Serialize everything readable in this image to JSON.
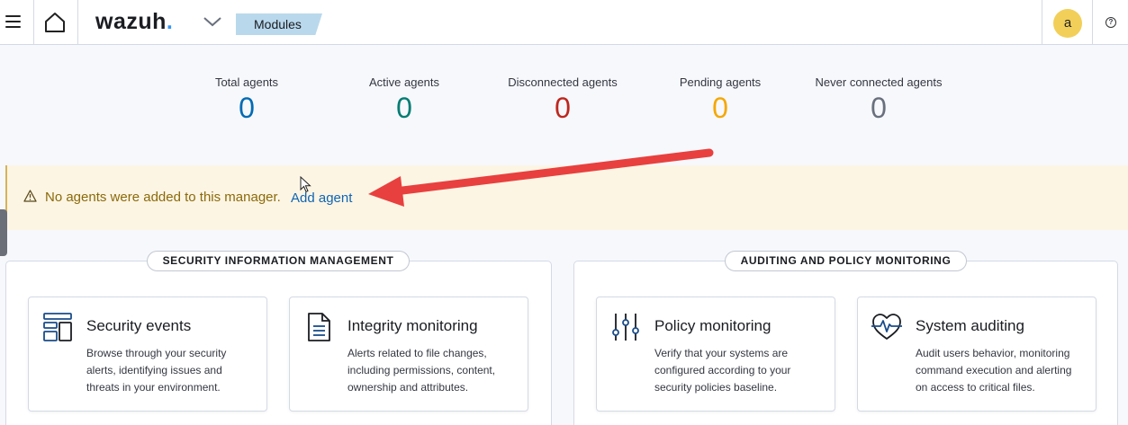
{
  "header": {
    "logo_text": "wazuh",
    "logo_dot": ".",
    "breadcrumb": "Modules",
    "avatar_letter": "a",
    "help_glyph": "?"
  },
  "stats": [
    {
      "label": "Total agents",
      "value": "0",
      "color": "#006bb4"
    },
    {
      "label": "Active agents",
      "value": "0",
      "color": "#017d73"
    },
    {
      "label": "Disconnected agents",
      "value": "0",
      "color": "#bd271e"
    },
    {
      "label": "Pending agents",
      "value": "0",
      "color": "#f5a700"
    },
    {
      "label": "Never connected agents",
      "value": "0",
      "color": "#69707d"
    }
  ],
  "callout": {
    "message": "No agents were added to this manager.",
    "link": "Add agent"
  },
  "sections": [
    {
      "title": "SECURITY INFORMATION MANAGEMENT",
      "cards": [
        {
          "title": "Security events",
          "description": "Browse through your security alerts, identifying issues and threats in your environment.",
          "icon": "security-events-icon"
        },
        {
          "title": "Integrity monitoring",
          "description": "Alerts related to file changes, including permissions, content, ownership and attributes.",
          "icon": "document-icon"
        }
      ]
    },
    {
      "title": "AUDITING AND POLICY MONITORING",
      "cards": [
        {
          "title": "Policy monitoring",
          "description": "Verify that your systems are configured according to your security policies baseline.",
          "icon": "sliders-icon"
        },
        {
          "title": "System auditing",
          "description": "Audit users behavior, monitoring command execution and alerting on access to critical files.",
          "icon": "heartbeat-icon"
        }
      ]
    }
  ],
  "colors": {
    "accent": "#0f65b4",
    "callout_bg": "#fdf5e4",
    "annotation_arrow": "#e8403e"
  }
}
